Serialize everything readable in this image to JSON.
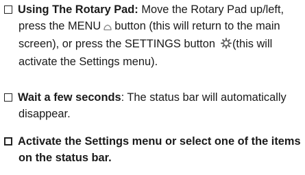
{
  "items": [
    {
      "heading": "Using The Rotary Pad:",
      "text_before_home": " Move the Rotary Pad up/left, press the MENU",
      "text_after_home": "button (this will return to the main screen), or press the SETTINGS button",
      "text_after_gear": "(this will activate the Settings menu).",
      "home_icon": "home-icon",
      "settings_icon": "gear-icon"
    },
    {
      "heading": "Wait a few seconds",
      "text": ": The status bar will automatically disappear."
    },
    {
      "heading": "Activate the Settings menu or select one of the items on the status bar."
    }
  ]
}
